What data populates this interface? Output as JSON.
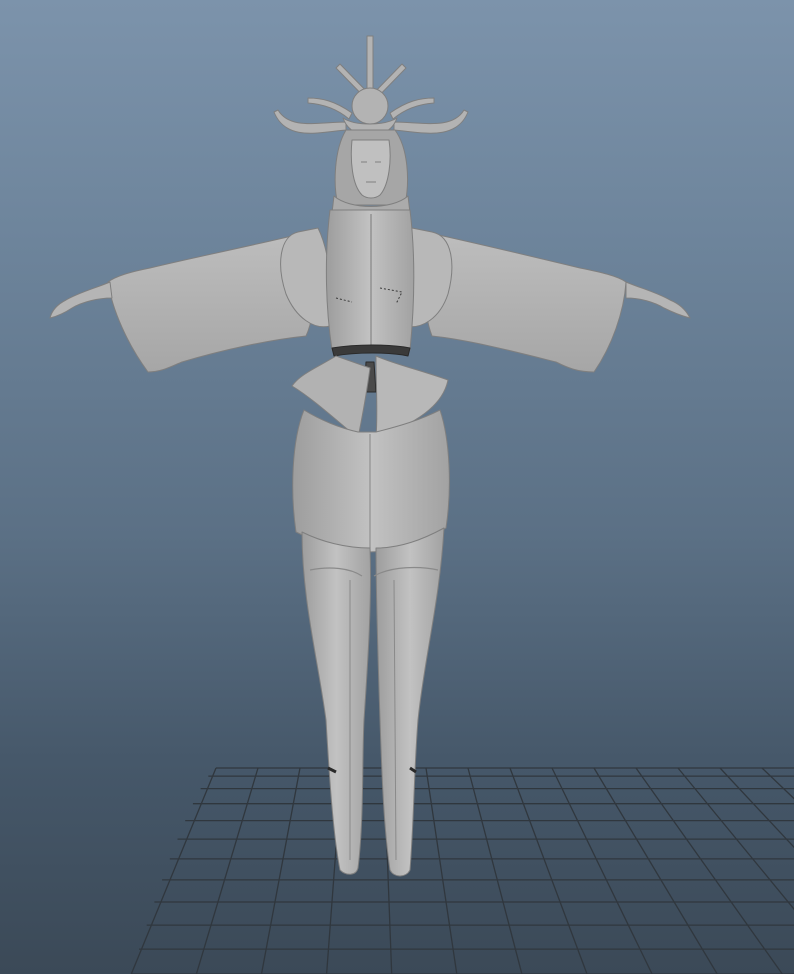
{
  "viewport": {
    "view": "perspective",
    "background": {
      "top": "#7c93ab",
      "bottom": "#3b4957"
    },
    "grid": {
      "visible": true,
      "color": "#30373e"
    },
    "model": {
      "shading": "smooth-shaded",
      "color": "#b5b5b5",
      "pose": "T-pose"
    }
  }
}
